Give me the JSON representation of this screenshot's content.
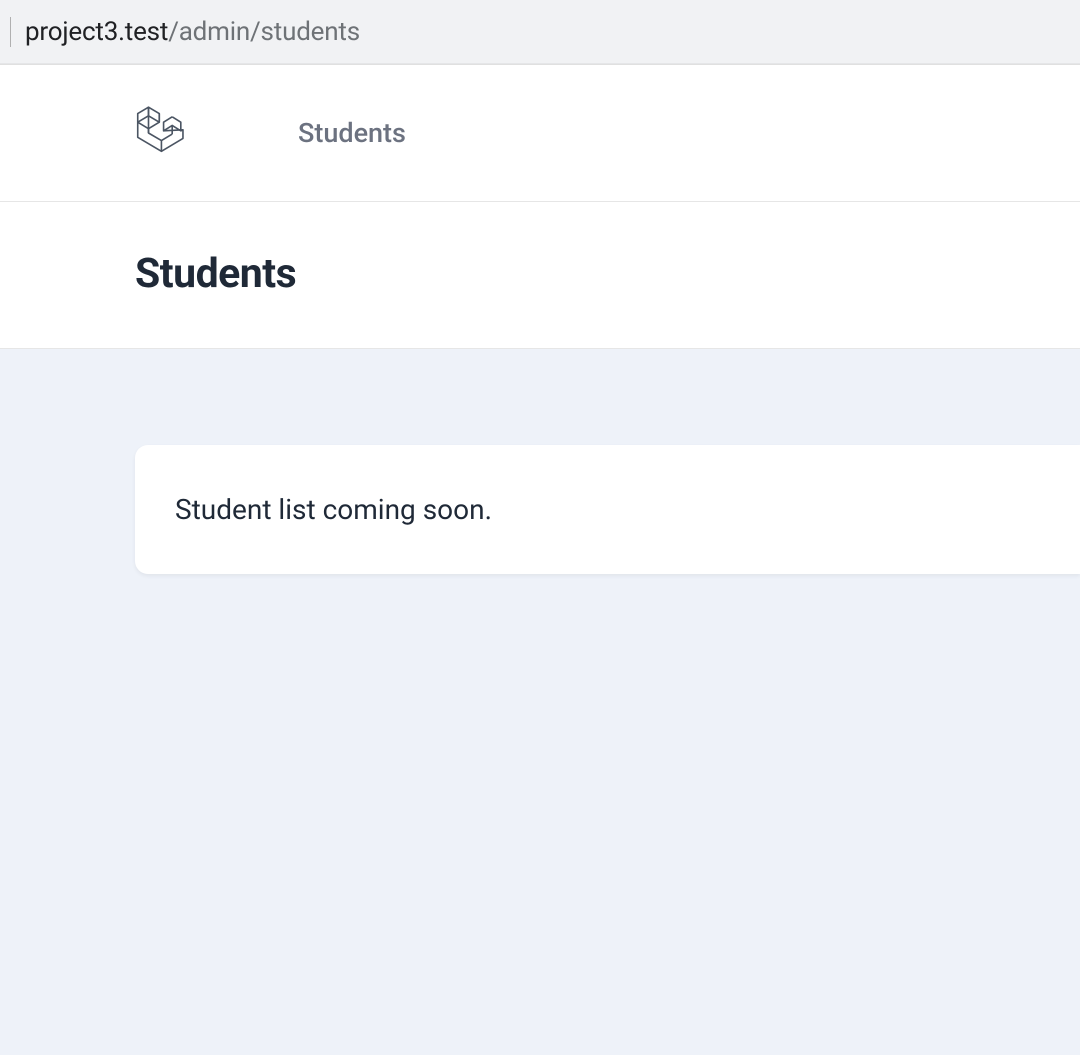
{
  "url": {
    "domain": "project3.test",
    "path": "/admin/students"
  },
  "nav": {
    "link_label": "Students"
  },
  "page": {
    "title": "Students"
  },
  "content": {
    "message": "Student list coming soon."
  }
}
